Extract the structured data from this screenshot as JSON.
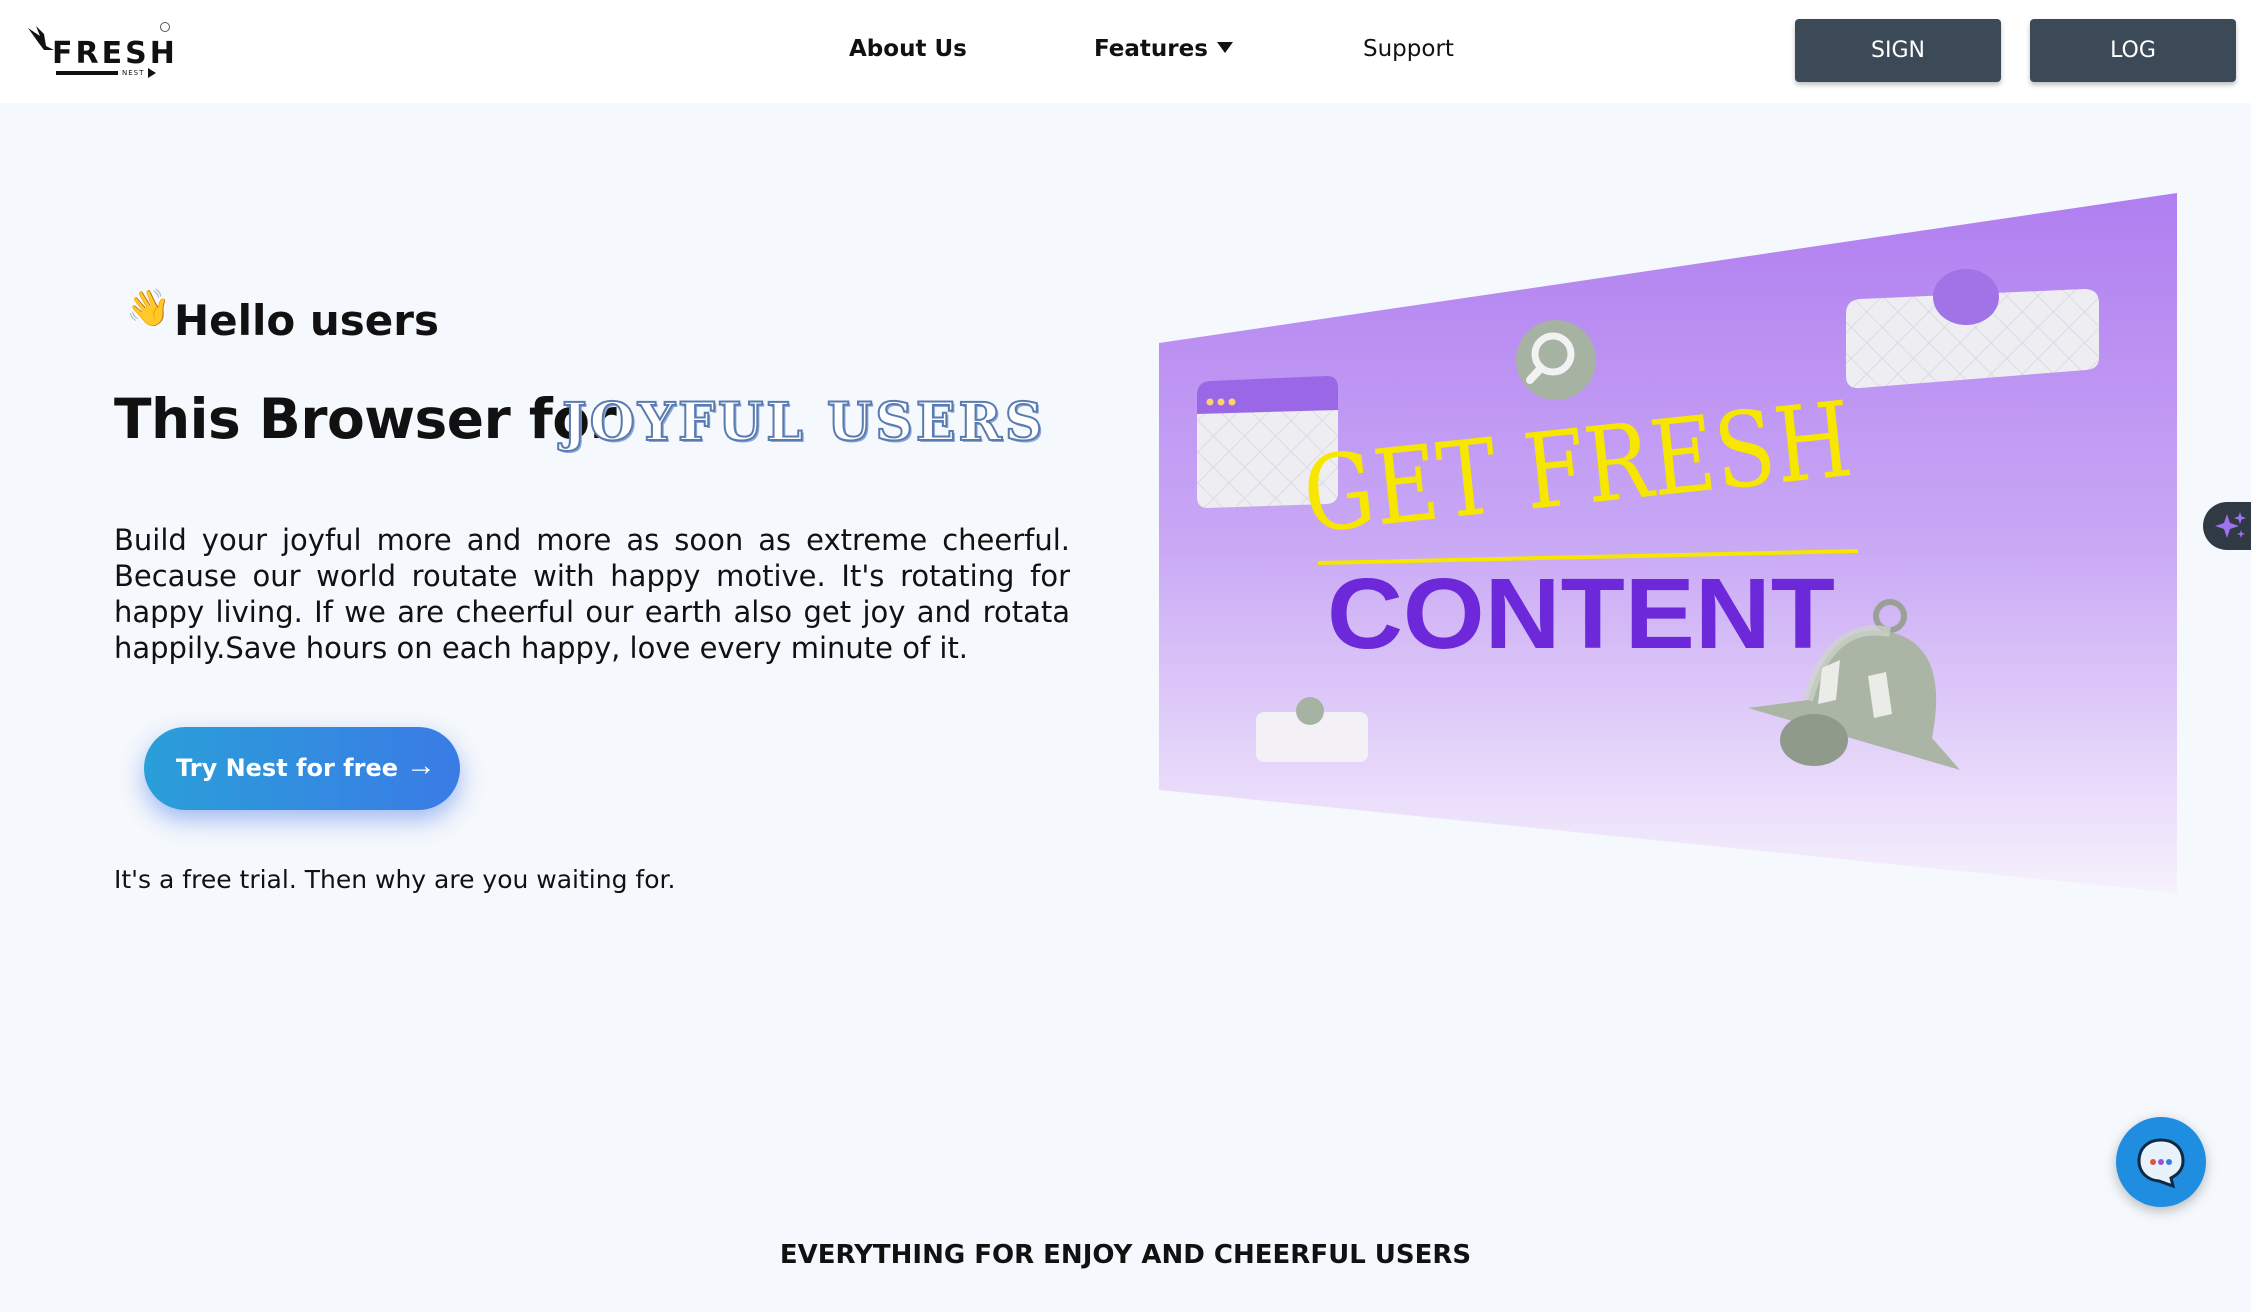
{
  "brand": {
    "name": "FRESH",
    "tagline": "NEST"
  },
  "nav": {
    "about": "About Us",
    "features": "Features",
    "support": "Support",
    "sign": "SIGN",
    "log": "LOG"
  },
  "hero": {
    "greeting": "Hello users",
    "greeting_icon": "waving-hand-icon",
    "headline": "This Browser for",
    "headline_accent": "JOYFUL USERS",
    "body": "Build your joyful more and more as soon as extreme cheerful. Because our world routate with happy motive. It's rotating for happy living. If we are cheerful our earth also get joy and rotata happily.Save hours on each happy, love every minute of it.",
    "cta_label": "Try Nest for free",
    "cta_arrow": "→",
    "trial_note": "It's a free trial. Then why are you waiting for."
  },
  "hero_image": {
    "line1": "GET FRESH",
    "line2": "CONTENT",
    "accent_purple": "#6d28d9",
    "accent_yellow": "#f6e600"
  },
  "sections": {
    "features_title": "EVERYTHING FOR ENJOY AND CHEERFUL USERS"
  },
  "colors": {
    "button_dark": "#3c4a57",
    "cta_start": "#2a9fd8",
    "cta_end": "#3a7be6",
    "background": "#f5f8fc"
  }
}
